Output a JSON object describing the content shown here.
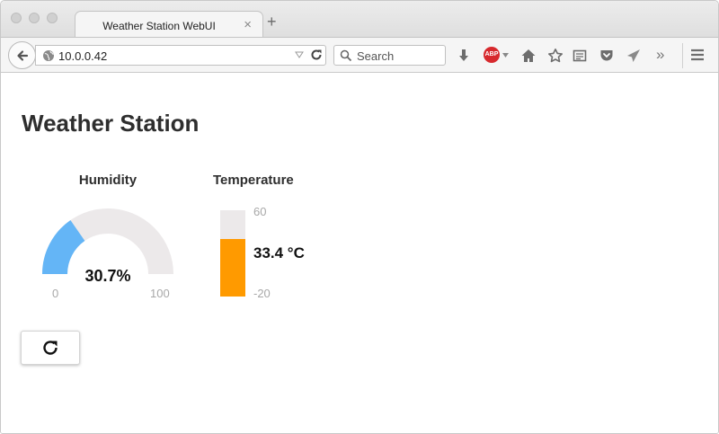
{
  "browser": {
    "tab_title": "Weather Station WebUI",
    "tab_close_glyph": "×",
    "new_tab_glyph": "+",
    "url": "10.0.0.42",
    "search_placeholder": "Search",
    "abp_label": "ABP",
    "overflow_glyph": "»",
    "icons": [
      "back-icon",
      "globe-icon",
      "dropdown-icon",
      "reload-icon",
      "search-icon",
      "download-icon",
      "adblock-icon",
      "home-icon",
      "bookmark-star-icon",
      "reading-list-icon",
      "pocket-icon",
      "send-icon",
      "overflow-icon",
      "menu-icon"
    ]
  },
  "page": {
    "title": "Weather Station",
    "humidity": {
      "label": "Humidity",
      "value": 30.7,
      "value_text": "30.7%",
      "min": 0,
      "max": 100,
      "min_text": "0",
      "max_text": "100",
      "fill_color": "#64b5f6",
      "track_color": "#ece9ea"
    },
    "temperature": {
      "label": "Temperature",
      "value": 33.4,
      "value_text": "33.4 °C",
      "min": -20,
      "max": 60,
      "min_text": "-20",
      "max_text": "60",
      "fill_color": "#ff9a00",
      "track_color": "#ece9ea"
    },
    "refresh_icon": "refresh-icon"
  }
}
